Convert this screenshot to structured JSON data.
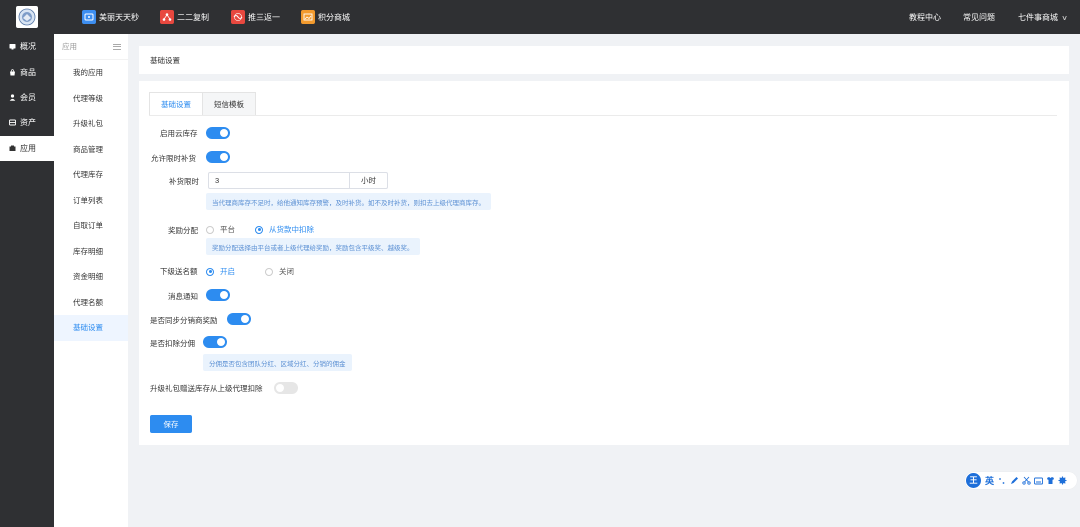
{
  "topbar": {
    "apps": [
      {
        "label": "美丽天天秒",
        "color": "#3d8ef0",
        "icon": "coupon-icon"
      },
      {
        "label": "二二复制",
        "color": "#e8483f",
        "icon": "share-icon"
      },
      {
        "label": "推三返一",
        "color": "#e8483f",
        "icon": "handshake-icon"
      },
      {
        "label": "积分商城",
        "color": "#f29a2e",
        "icon": "image-icon"
      }
    ],
    "right": {
      "tutorial": "教程中心",
      "faq": "常见问题",
      "shop": "七件事商城"
    }
  },
  "sidebar": {
    "items": [
      {
        "label": "概况",
        "icon": "overview-icon"
      },
      {
        "label": "商品",
        "icon": "goods-icon"
      },
      {
        "label": "会员",
        "icon": "member-icon"
      },
      {
        "label": "资产",
        "icon": "asset-icon"
      },
      {
        "label": "应用",
        "icon": "app-icon",
        "active": true
      }
    ]
  },
  "submenu": {
    "title": "应用",
    "items": [
      {
        "label": "我的应用"
      },
      {
        "label": "代理等级"
      },
      {
        "label": "升级礼包"
      },
      {
        "label": "商品管理"
      },
      {
        "label": "代理库存"
      },
      {
        "label": "订单列表"
      },
      {
        "label": "自取订单"
      },
      {
        "label": "库存明细"
      },
      {
        "label": "资金明细"
      },
      {
        "label": "代理名额"
      },
      {
        "label": "基础设置",
        "active": true
      }
    ]
  },
  "breadcrumb": "基础设置",
  "tabs": [
    {
      "label": "基础设置",
      "active": true
    },
    {
      "label": "短信模板",
      "active": false
    }
  ],
  "form": {
    "cloud_stock": {
      "label": "启用云库存",
      "on": true
    },
    "allow_timed_restock": {
      "label": "允许限时补货",
      "on": true
    },
    "restock_limit": {
      "label": "补货限时",
      "value": "3",
      "suffix": "小时",
      "hint": "当代理商库存不足时，给他通知库存预警，及时补货。如不及时补货，则扣去上级代理商库存。"
    },
    "reward_distribution": {
      "label": "奖励分配",
      "options": [
        "平台",
        "从货款中扣除"
      ],
      "selected": 1,
      "hint": "奖励分配选择由平台或者上级代理给奖励，奖励包含平级奖、越级奖。"
    },
    "subordinate_quota": {
      "label": "下级送名额",
      "options": [
        "开启",
        "关闭"
      ],
      "selected": 0
    },
    "message_notify": {
      "label": "消息通知",
      "on": true
    },
    "sync_distributor_reward": {
      "label": "是否同步分销商奖励",
      "on": true
    },
    "deduct_commission": {
      "label": "是否扣除分佣",
      "on": true,
      "hint": "分佣是否包含团队分红、区域分红、分销的佣金"
    },
    "upgrade_gift_deduct": {
      "label": "升级礼包赠送库存从上级代理扣除",
      "on": false
    }
  },
  "save_label": "保存",
  "ime": {
    "logo": "王",
    "lang": "英"
  },
  "colors": {
    "primary": "#2d8cf0",
    "topbar": "#2f3033",
    "hint_bg": "#eaf3fd"
  }
}
